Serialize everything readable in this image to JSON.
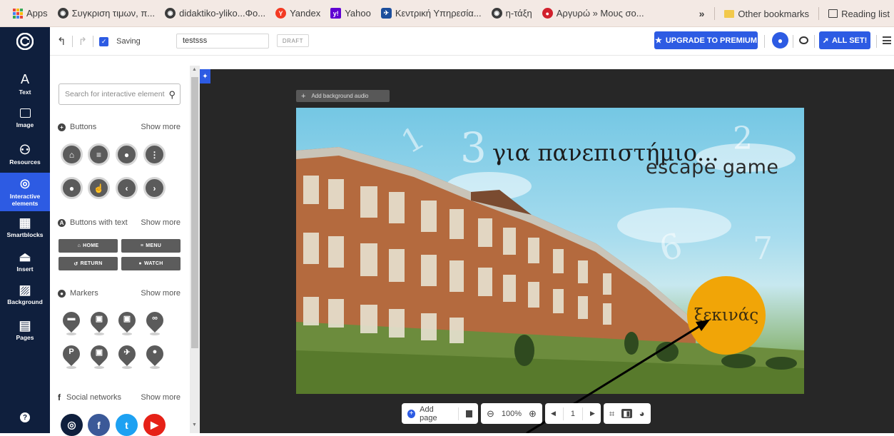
{
  "bookmarks": {
    "apps_label": "Apps",
    "items": [
      {
        "label": "Συγκριση τιμων, π...",
        "icon": "globe-icon",
        "color": "#3c3c3c"
      },
      {
        "label": "didaktiko-yliko...Φο...",
        "icon": "globe-icon",
        "color": "#3c3c3c"
      },
      {
        "label": "Yandex",
        "icon": "yandex-icon",
        "color": "#f33a23"
      },
      {
        "label": "Yahoo",
        "icon": "yahoo-icon",
        "color": "#6001d2"
      },
      {
        "label": "Κεντρική Υπηρεσία...",
        "icon": "bird-icon",
        "color": "#1c4e9c"
      },
      {
        "label": "η-τάξη",
        "icon": "globe-icon",
        "color": "#3c3c3c"
      },
      {
        "label": "Αργυρώ » Μους σο...",
        "icon": "cake-icon",
        "color": "#d1202c"
      }
    ],
    "overflow": "»",
    "other": "Other bookmarks",
    "reading_list": "Reading list"
  },
  "toolbar": {
    "saving_label": "Saving",
    "project_name": "testsss",
    "draft_label": "DRAFT",
    "premium_label": "UPGRADE TO PREMIUM",
    "allset_label": "ALL SET!"
  },
  "sidebar": {
    "items": [
      {
        "label": "Text",
        "icon": "A"
      },
      {
        "label": "Image",
        "icon": "🖼"
      },
      {
        "label": "Resources",
        "icon": "⚇"
      },
      {
        "label": "Interactive elements",
        "icon": "◎"
      },
      {
        "label": "Smartblocks",
        "icon": "▦"
      },
      {
        "label": "Insert",
        "icon": "⏏"
      },
      {
        "label": "Background",
        "icon": "▨"
      },
      {
        "label": "Pages",
        "icon": "▤"
      }
    ],
    "help": "?"
  },
  "panel": {
    "search_placeholder": "Search for interactive elements",
    "buttons_title": "Buttons",
    "buttons_more": "Show more",
    "text_buttons_title": "Buttons with text",
    "text_buttons_more": "Show more",
    "text_buttons": [
      "HOME",
      "MENU",
      "RETURN",
      "WATCH"
    ],
    "markers_title": "Markers",
    "markers_more": "Show more",
    "social_title": "Social networks",
    "social_more": "Show more"
  },
  "canvas": {
    "bg_audio_label": "Add background audio",
    "title_main": "για πανεπιστήμιο...",
    "title_sub": "escape game",
    "start_label": "ξεκινάς"
  },
  "bottom": {
    "add_page": "Add page",
    "zoom": "100%",
    "page": "1"
  }
}
